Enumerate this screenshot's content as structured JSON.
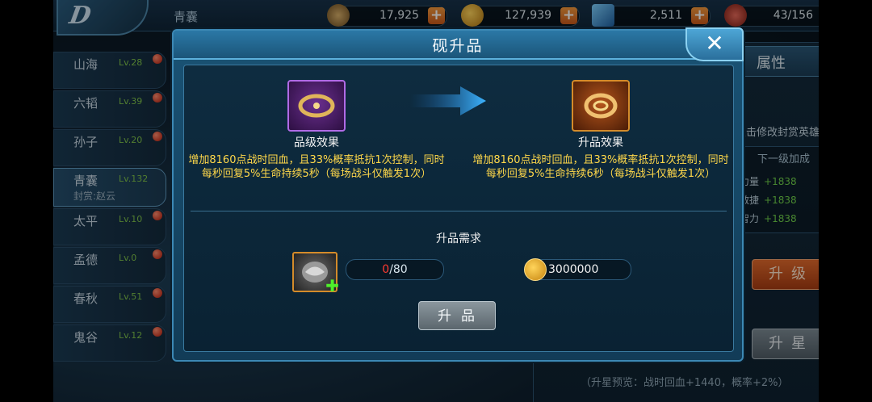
{
  "topbar": {
    "hero_name": "青囊",
    "resources": [
      {
        "icon": "wings-icon",
        "value": "17,925"
      },
      {
        "icon": "gold-coin-icon",
        "value": "127,939"
      },
      {
        "icon": "gem-icon",
        "value": "2,511"
      },
      {
        "icon": "stamina-icon",
        "value": "43/156"
      }
    ],
    "plus_label": "+"
  },
  "hero_list": [
    {
      "name": "山海",
      "level": "Lv.28",
      "sub": ""
    },
    {
      "name": "六韬",
      "level": "Lv.39",
      "sub": ""
    },
    {
      "name": "孙子",
      "level": "Lv.20",
      "sub": ""
    },
    {
      "name": "青囊",
      "level": "Lv.132",
      "sub": "封赏:赵云"
    },
    {
      "name": "太平",
      "level": "Lv.10",
      "sub": ""
    },
    {
      "name": "孟德",
      "level": "Lv.0",
      "sub": ""
    },
    {
      "name": "春秋",
      "level": "Lv.51",
      "sub": ""
    },
    {
      "name": "鬼谷",
      "level": "Lv.12",
      "sub": ""
    }
  ],
  "right_panel": {
    "tab_label": "属性",
    "tip": "点击修改封赏英雄",
    "table_header": "下一级加成",
    "rows": [
      {
        "label": "力量",
        "bonus": "+1838"
      },
      {
        "label": "敏捷",
        "bonus": "+1838"
      },
      {
        "label": "智力",
        "bonus": "+1838"
      }
    ],
    "level_button": "升级",
    "star_button": "升星",
    "preview": "（升星预览：战时回血+1440，概率+2%）"
  },
  "modal": {
    "title": "砚升品",
    "close": "✕",
    "current": {
      "title": "品级效果",
      "desc": "增加8160点战时回血，且33%概率抵抗1次控制，同时每秒回复5%生命持续5秒（每场战斗仅触发1次）"
    },
    "next": {
      "title": "升品效果",
      "desc": "增加8160点战时回血，且33%概率抵抗1次控制，同时每秒回复5%生命持续6秒（每场战斗仅触发1次）"
    },
    "requirement_title": "升品需求",
    "material_have": "0",
    "material_need": "/80",
    "coin_cost": "3000000",
    "upgrade_button": "升品"
  },
  "colors": {
    "accent_orange": "#e26a2c",
    "effect_text": "#ffd84a",
    "shortage_red": "#ff3b30",
    "bonus_green": "#6fd04a"
  }
}
